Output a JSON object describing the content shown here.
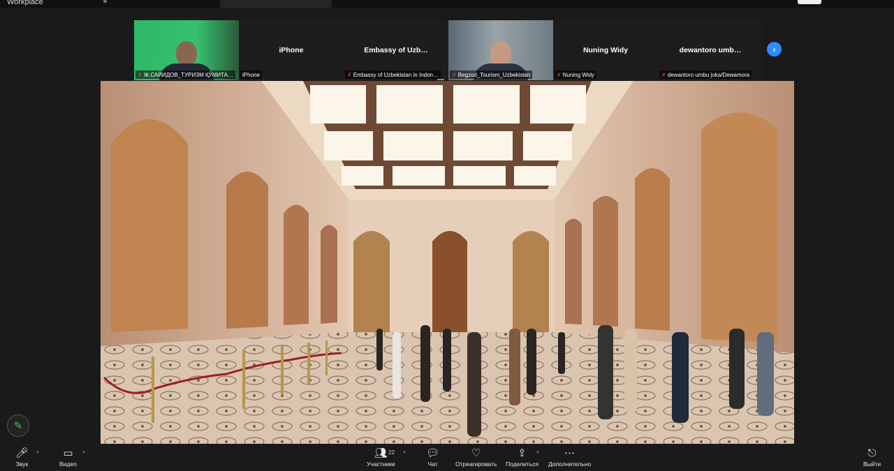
{
  "app": {
    "title": "Workplace"
  },
  "gallery": {
    "tiles": [
      {
        "id": "p1",
        "display_name": "",
        "label": "Ж.САЙИДОВ_ТУРИЗМ ҚЎМИТА…",
        "muted": true,
        "has_video": true
      },
      {
        "id": "p2",
        "display_name": "iPhone",
        "label": "iPhone",
        "muted": false,
        "has_video": false
      },
      {
        "id": "p3",
        "display_name": "Embassy of Uzb…",
        "label": "Embassy of Uzbekistan in Indon…",
        "muted": true,
        "has_video": false
      },
      {
        "id": "p4",
        "display_name": "",
        "label": "Begzod_Tourism_Uzbekistan",
        "muted": true,
        "has_video": true
      },
      {
        "id": "p5",
        "display_name": "Nuning Widy",
        "label": "Nuning Widy",
        "muted": true,
        "has_video": false
      },
      {
        "id": "p6",
        "display_name": "dewantoro umb…",
        "label": "dewantoro umbu joka/Dewamora",
        "muted": true,
        "has_video": false
      }
    ],
    "next_icon": "chevron-right-icon"
  },
  "toolbar": {
    "audio": {
      "label": "Звук",
      "icon": "microphone-muted-icon"
    },
    "video": {
      "label": "Видео",
      "icon": "video-camera-icon"
    },
    "participants": {
      "label": "Участники",
      "count": "22",
      "icon": "participants-icon"
    },
    "chat": {
      "label": "Чат",
      "icon": "chat-icon"
    },
    "react": {
      "label": "Отреагировать",
      "icon": "heart-icon"
    },
    "share": {
      "label": "Поделиться",
      "icon": "share-screen-icon"
    },
    "more": {
      "label": "Дополнительно",
      "icon": "more-icon"
    },
    "leave": {
      "label": "Выйти",
      "icon": "leave-icon"
    }
  },
  "colors": {
    "accent": "#2d8cff",
    "muted": "#e0413d",
    "background": "#1a1a1a",
    "annotate": "#3ec45b"
  }
}
